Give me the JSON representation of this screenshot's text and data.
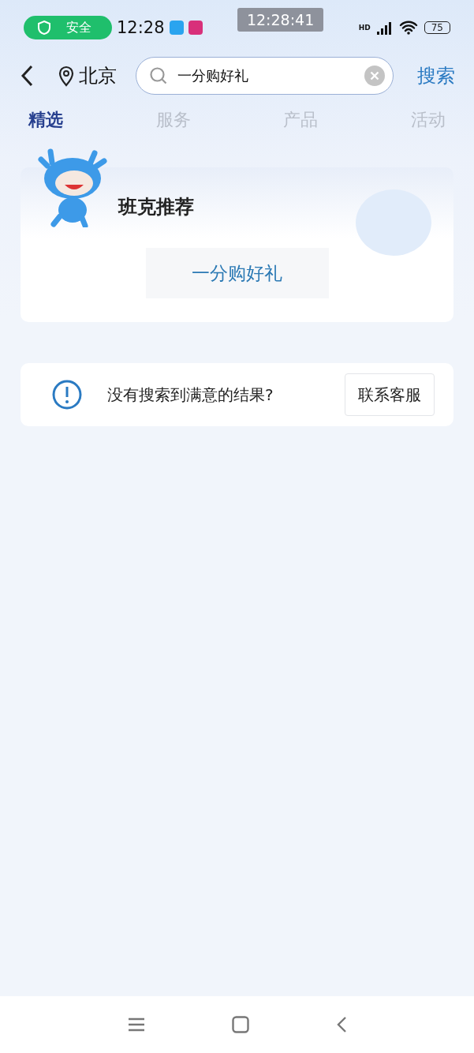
{
  "status_bar": {
    "security_badge": "安全",
    "time": "12:28",
    "recorder_clock": "12:28:41",
    "network": "HD",
    "battery": "75"
  },
  "header": {
    "location": "北京",
    "search": {
      "value": "一分购好礼"
    },
    "search_button": "搜索"
  },
  "tabs": [
    {
      "label": "精选",
      "selected": true
    },
    {
      "label": "服务",
      "selected": false
    },
    {
      "label": "产品",
      "selected": false
    },
    {
      "label": "活动",
      "selected": false
    }
  ],
  "recommend_card": {
    "title": "班克推荐",
    "suggestions": [
      "一分购好礼"
    ]
  },
  "help_card": {
    "message": "没有搜索到满意的结果?",
    "button": "联系客服"
  }
}
